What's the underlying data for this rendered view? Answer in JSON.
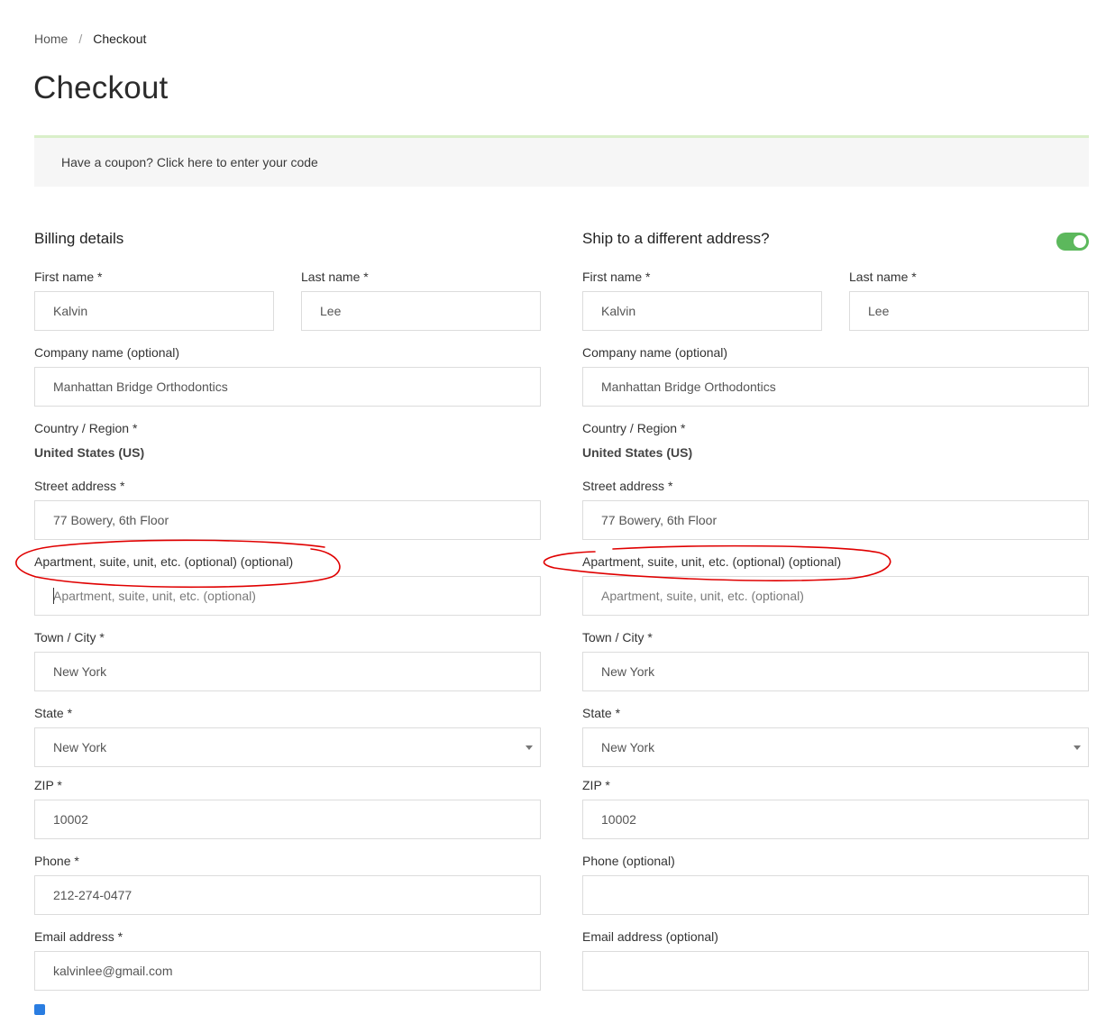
{
  "breadcrumb": {
    "home": "Home",
    "separator": "/",
    "current": "Checkout"
  },
  "page_title": "Checkout",
  "coupon": {
    "text": "Have a coupon? Click here to enter your code"
  },
  "colors": {
    "toggle_on": "#5cb85c",
    "annotation": "#e00000",
    "coupon_border": "#d9efc9"
  },
  "billing": {
    "title": "Billing details",
    "first_name": {
      "label": "First name *",
      "value": "Kalvin"
    },
    "last_name": {
      "label": "Last name *",
      "value": "Lee"
    },
    "company": {
      "label": "Company name (optional)",
      "value": "Manhattan Bridge Orthodontics"
    },
    "country": {
      "label": "Country / Region *",
      "value": "United States (US)"
    },
    "street": {
      "label": "Street address *",
      "value": "77 Bowery, 6th Floor"
    },
    "apartment": {
      "label": "Apartment, suite, unit, etc. (optional) (optional)",
      "placeholder": "Apartment, suite, unit, etc. (optional)"
    },
    "city": {
      "label": "Town / City *",
      "value": "New York"
    },
    "state": {
      "label": "State *",
      "value": "New York"
    },
    "zip": {
      "label": "ZIP *",
      "value": "10002"
    },
    "phone": {
      "label": "Phone *",
      "value": "212-274-0477"
    },
    "email": {
      "label": "Email address *",
      "value": "kalvinlee@gmail.com"
    }
  },
  "shipping": {
    "title": "Ship to a different address?",
    "toggle_state": "on",
    "first_name": {
      "label": "First name *",
      "value": "Kalvin"
    },
    "last_name": {
      "label": "Last name *",
      "value": "Lee"
    },
    "company": {
      "label": "Company name (optional)",
      "value": "Manhattan Bridge Orthodontics"
    },
    "country": {
      "label": "Country / Region *",
      "value": "United States (US)"
    },
    "street": {
      "label": "Street address *",
      "value": "77 Bowery, 6th Floor"
    },
    "apartment": {
      "label": "Apartment, suite, unit, etc. (optional) (optional)",
      "placeholder": "Apartment, suite, unit, etc. (optional)"
    },
    "city": {
      "label": "Town / City *",
      "value": "New York"
    },
    "state": {
      "label": "State *",
      "value": "New York"
    },
    "zip": {
      "label": "ZIP *",
      "value": "10002"
    },
    "phone": {
      "label": "Phone (optional)",
      "value": ""
    },
    "email": {
      "label": "Email address (optional)",
      "value": ""
    }
  }
}
